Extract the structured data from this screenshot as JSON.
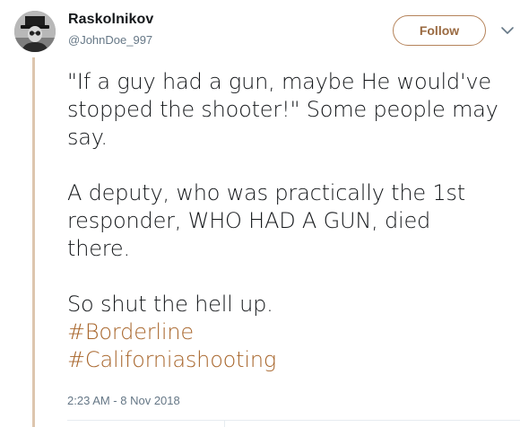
{
  "author": {
    "name": "Raskolnikov",
    "handle": "@JohnDoe_997",
    "avatar_icon": "user-avatar-photo"
  },
  "follow_button": {
    "label": "Follow"
  },
  "menu_caret": {
    "icon": "chevron-down-icon"
  },
  "tweet": {
    "paragraph1_line1": "\"If a guy had a gun, maybe He would've",
    "paragraph1_line2": "stopped the shooter!\" Some people may",
    "paragraph1_line3": "say.",
    "paragraph2_line1": "A deputy, who was practically the 1st",
    "paragraph2_line2": "responder, WHO HAD A GUN, died",
    "paragraph2_line3": "there.",
    "paragraph3_line1": "So shut the hell up.",
    "hashtags": [
      "#Borderline",
      "#Californiashooting"
    ]
  },
  "timestamp": "2:23 AM - 8 Nov 2018",
  "colors": {
    "accent": "#a8662c",
    "follow_border": "#b5835a",
    "thread_line": "#ddc6ae",
    "secondary_text": "#657786"
  }
}
